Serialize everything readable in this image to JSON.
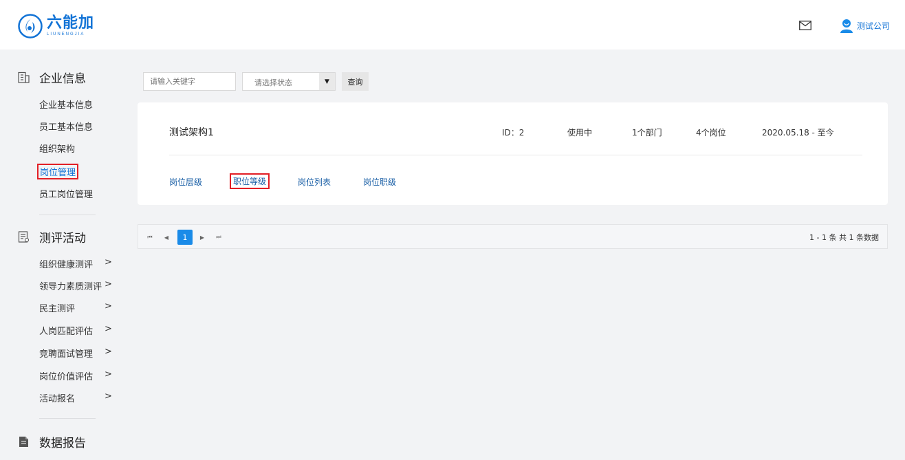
{
  "header": {
    "logo_cn": "六能加",
    "logo_en": "LIUNENGJIA",
    "user_name": "测试公司"
  },
  "sidebar": {
    "sections": [
      {
        "title": "企业信息",
        "icon": "building-icon",
        "items": [
          {
            "label": "企业基本信息"
          },
          {
            "label": "员工基本信息"
          },
          {
            "label": "组织架构"
          },
          {
            "label": "岗位管理",
            "active": true
          },
          {
            "label": "员工岗位管理"
          }
        ]
      },
      {
        "title": "测评活动",
        "icon": "clipboard-icon",
        "items": [
          {
            "label": "组织健康测评",
            "arrow": ">"
          },
          {
            "label": "领导力素质测评",
            "arrow": ">"
          },
          {
            "label": "民主测评",
            "arrow": ">"
          },
          {
            "label": "人岗匹配评估",
            "arrow": ">"
          },
          {
            "label": "竞聘面试管理",
            "arrow": ">"
          },
          {
            "label": "岗位价值评估",
            "arrow": ">"
          },
          {
            "label": "活动报名",
            "arrow": ">"
          }
        ]
      },
      {
        "title": "数据报告",
        "icon": "report-icon",
        "items": []
      }
    ]
  },
  "search": {
    "keyword_placeholder": "请输入关键字",
    "status_placeholder": "请选择状态",
    "query_label": "查询"
  },
  "card": {
    "name": "测试架构1",
    "id_text": "ID：2",
    "status": "使用中",
    "departments": "1个部门",
    "positions": "4个岗位",
    "date_range": "2020.05.18 - 至今",
    "tabs": [
      {
        "label": "岗位层级"
      },
      {
        "label": "职位等级",
        "highlighted": true
      },
      {
        "label": "岗位列表"
      },
      {
        "label": "岗位职级"
      }
    ]
  },
  "pager": {
    "current_page": "1",
    "first": "⏮",
    "prev": "◀",
    "next": "▶",
    "last": "⏭",
    "summary": "1 - 1 条  共 1 条数据"
  },
  "colors": {
    "brand": "#1273d6",
    "highlight_border": "#e21e25",
    "page_active": "#1a8be8"
  }
}
